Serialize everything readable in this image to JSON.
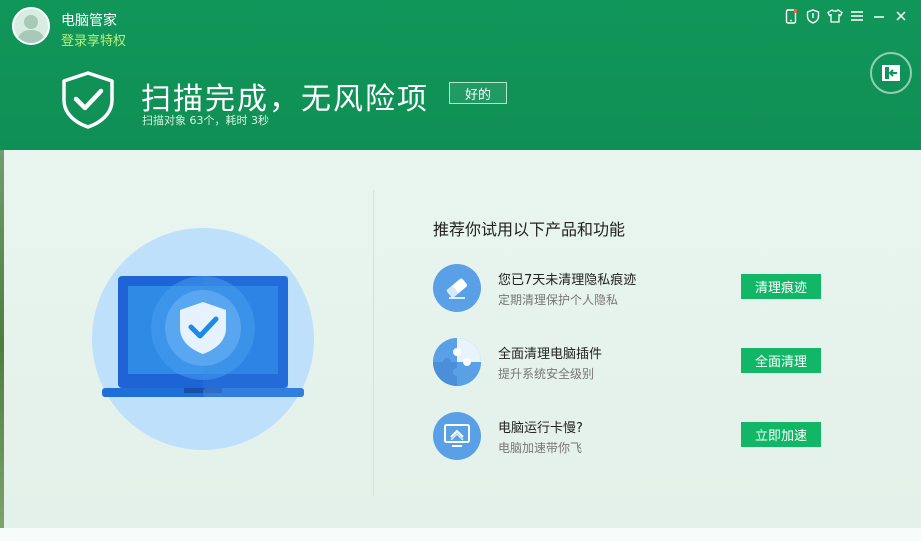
{
  "header": {
    "app_title": "电脑管家",
    "login_label": "登录享特权",
    "result_title": "扫描完成，无风险项",
    "ok_label": "好的",
    "scan_summary": "扫描对象 63个，耗时 3秒"
  },
  "window_controls": [
    "phone-icon",
    "shield-icon",
    "shirt-icon",
    "menu-icon",
    "minimize-icon",
    "close-icon"
  ],
  "recommend": {
    "title": "推荐你试用以下产品和功能",
    "items": [
      {
        "icon": "eraser-icon",
        "title": "您已7天未清理隐私痕迹",
        "subtitle": "定期清理保护个人隐私",
        "button": "清理痕迹"
      },
      {
        "icon": "puzzle-icon",
        "title": "全面清理电脑插件",
        "subtitle": "提升系统安全级别",
        "button": "全面清理"
      },
      {
        "icon": "speedup-icon",
        "title": "电脑运行卡慢?",
        "subtitle": "电脑加速带你飞",
        "button": "立即加速"
      }
    ]
  },
  "colors": {
    "header_green": "#11965a",
    "button_green": "#11b766",
    "icon_blue": "#5aa0e6",
    "login_link": "#b8f27a"
  }
}
